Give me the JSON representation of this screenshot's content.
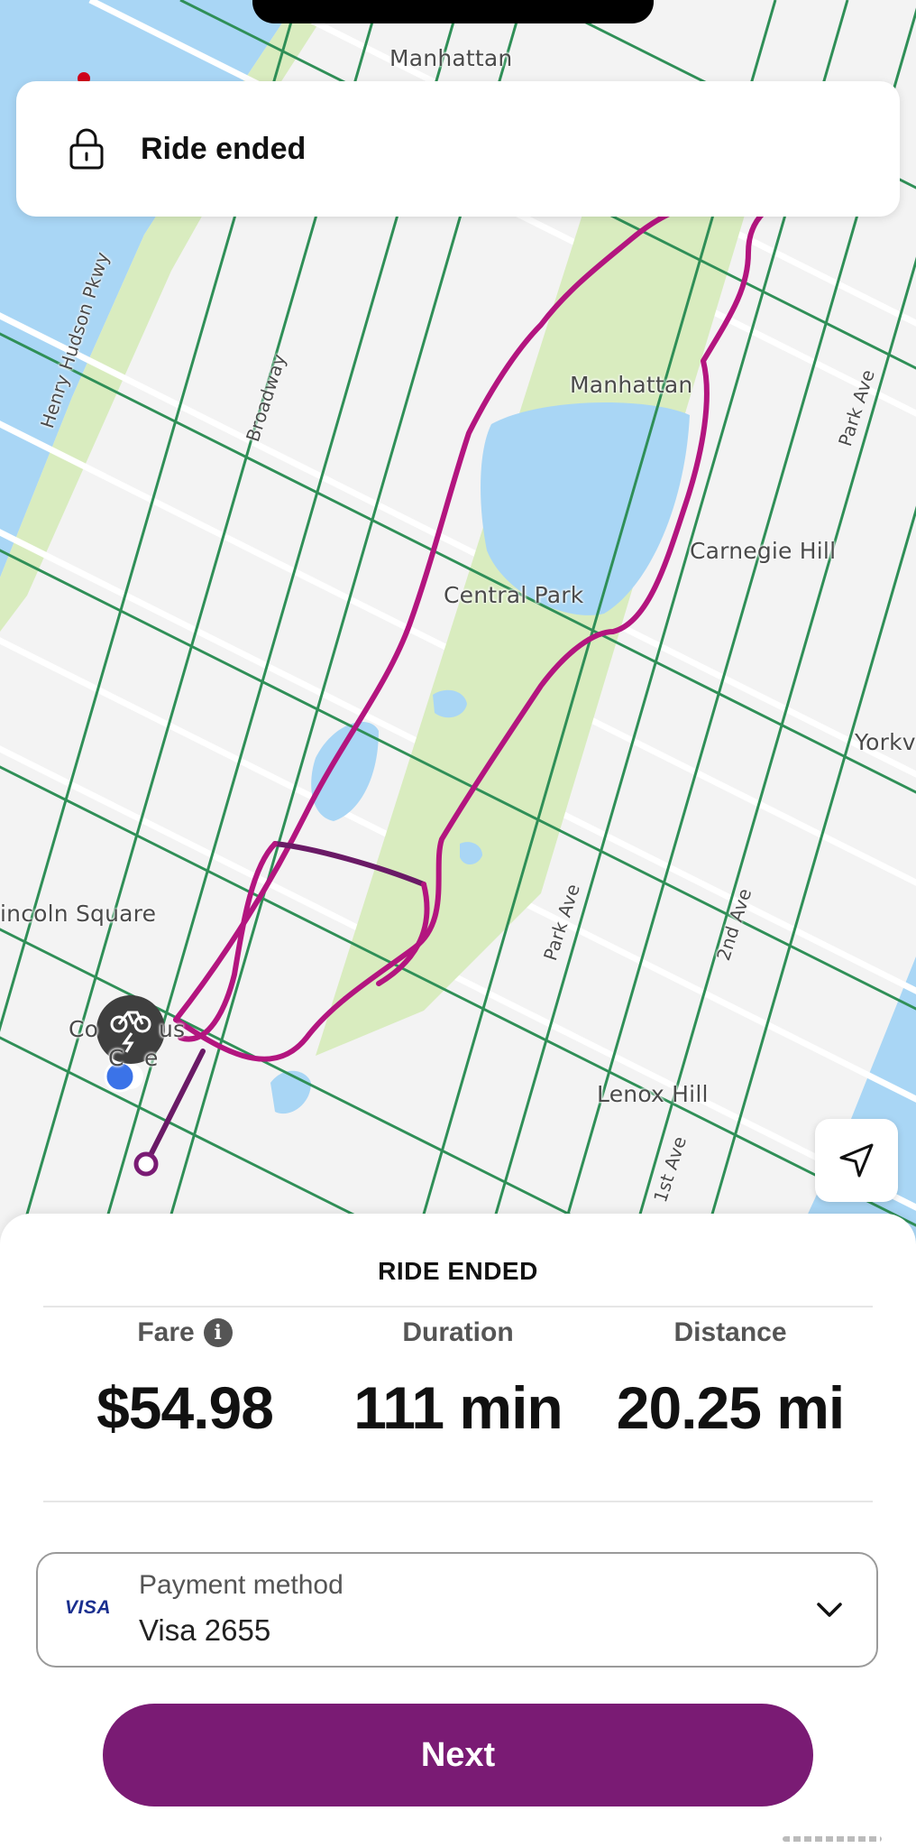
{
  "map": {
    "labels": [
      {
        "id": "manhattan-top",
        "text": "Manhattan"
      },
      {
        "id": "manhattan-mid",
        "text": "Manhattan"
      },
      {
        "id": "henry-hudson",
        "text": "Henry Hudson Pkwy"
      },
      {
        "id": "broadway",
        "text": "Broadway"
      },
      {
        "id": "park-ave-top",
        "text": "Park Ave"
      },
      {
        "id": "carnegie-hill",
        "text": "Carnegie Hill"
      },
      {
        "id": "central-park",
        "text": "Central Park"
      },
      {
        "id": "yorkville",
        "text": "Yorkv"
      },
      {
        "id": "lincoln-square",
        "text": "incoln Square"
      },
      {
        "id": "columbus-circle-1",
        "text": "Co"
      },
      {
        "id": "columbus-circle-2",
        "text": "us"
      },
      {
        "id": "columbus-circle-3",
        "text": "C"
      },
      {
        "id": "columbus-circle-4",
        "text": "e"
      },
      {
        "id": "park-ave-bottom",
        "text": "Park Ave"
      },
      {
        "id": "second-ave",
        "text": "2nd Ave"
      },
      {
        "id": "lenox-hill",
        "text": "Lenox Hill"
      },
      {
        "id": "first-ave",
        "text": "1st Ave"
      }
    ],
    "colors": {
      "land": "#f3f3f3",
      "water": "#a9d6f5",
      "park": "#d9ecbf",
      "bike_lane": "#2f8f57",
      "route": "#b3157f",
      "route_dark": "#6a1a66"
    }
  },
  "notice": {
    "icon": "lock-icon",
    "title": "Ride ended"
  },
  "sheet": {
    "title": "RIDE ENDED",
    "stats": [
      {
        "label": "Fare",
        "value": "$54.98",
        "has_info": true
      },
      {
        "label": "Duration",
        "value": "111 min"
      },
      {
        "label": "Distance",
        "value": "20.25 mi"
      }
    ],
    "payment": {
      "brand": "VISA",
      "label": "Payment method",
      "value": "Visa 2655"
    },
    "next_label": "Next",
    "accent": "#7a1b74"
  }
}
